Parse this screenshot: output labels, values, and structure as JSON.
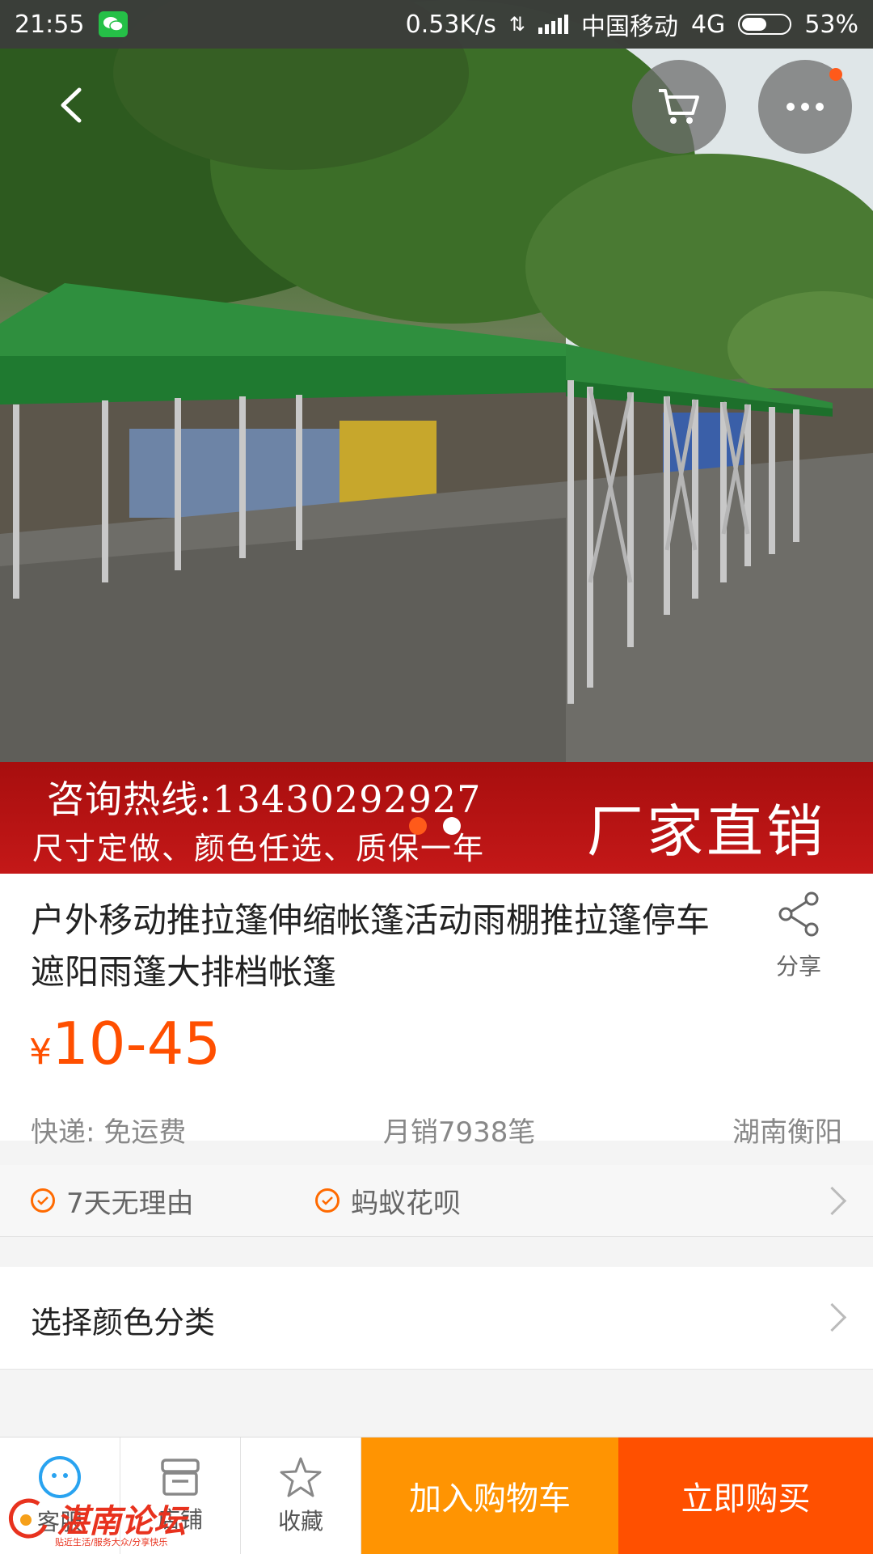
{
  "status_bar": {
    "time": "21:55",
    "network_speed": "0.53K/s",
    "carrier": "中国移动",
    "network_type": "4G",
    "battery": "53%",
    "battery_level": 0.53,
    "app_notification_icon": "wechat-icon"
  },
  "header": {
    "back_icon": "back-arrow-icon",
    "cart_icon": "cart-icon",
    "more_icon": "more-icon",
    "notification_dot_color": "#ff5a1a"
  },
  "banner": {
    "hotline": "咨询热线:13430292927",
    "slogan": "尺寸定做、颜色任选、质保一年",
    "highlight": "厂家直销"
  },
  "gallery": {
    "current_page": 1,
    "total_pages": 2
  },
  "product": {
    "title": "户外移动推拉篷伸缩帐篷活动雨棚推拉篷停车遮阳雨篷大排档帐篷",
    "share_label": "分享",
    "currency": "¥",
    "price": "10-45",
    "shipping": "快递: 免运费",
    "monthly_sales": "月销7938笔",
    "location": "湖南衡阳"
  },
  "guarantees": [
    "7天无理由",
    "蚂蚁花呗"
  ],
  "select_option": {
    "label": "选择颜色分类"
  },
  "bottom_bar": {
    "service_label": "客服",
    "shop_label": "店铺",
    "favorite_label": "收藏",
    "add_to_cart": "加入购物车",
    "buy_now": "立即购买"
  },
  "watermark": {
    "name": "湛南论坛",
    "tagline": "贴近生活/服务大众/分享快乐"
  },
  "colors": {
    "price": "#ff4f00",
    "cart_button": "#ff9402",
    "buy_button": "#ff5000",
    "banner": "#b51212"
  }
}
